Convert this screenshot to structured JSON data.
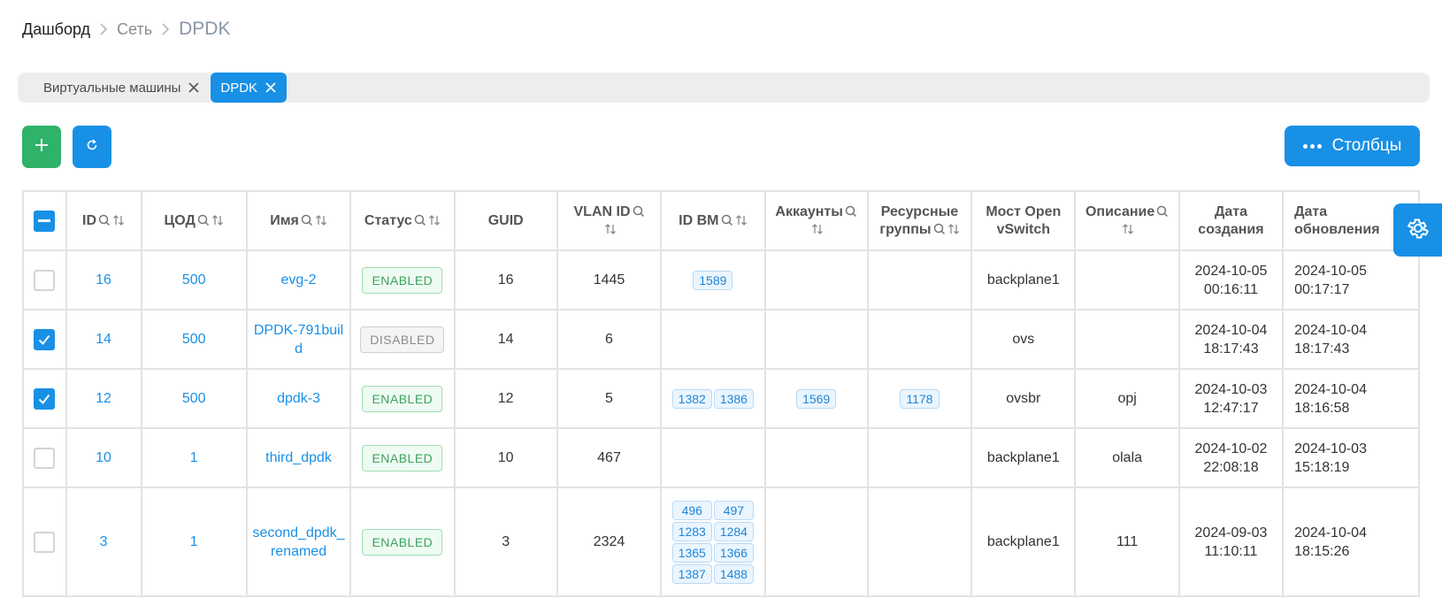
{
  "breadcrumb": {
    "home": "Дашборд",
    "section": "Сеть",
    "current": "DPDK"
  },
  "tabs": [
    {
      "label": "Виртуальные машины",
      "active": false
    },
    {
      "label": "DPDK",
      "active": true
    }
  ],
  "toolbar": {
    "add_icon": "plus-icon",
    "refresh_icon": "refresh-icon",
    "columns_label": "Столбцы"
  },
  "colors": {
    "accent": "#1890e6",
    "add": "#2fb26a",
    "enabled": "#3aa35e"
  },
  "table": {
    "headers": {
      "id": "ID",
      "dc": "ЦОД",
      "name": "Имя",
      "status": "Статус",
      "guid": "GUID",
      "vlan": "VLAN ID",
      "vm_ids": "ID ВМ",
      "accounts": "Аккаунты",
      "resource_groups": "Ресурсные группы",
      "ovs_bridge": "Мост Open vSwitch",
      "description": "Описание",
      "created": "Дата создания",
      "updated": "Дата обновления"
    },
    "rows": [
      {
        "checked": false,
        "id": "16",
        "dc": "500",
        "name": "evg-2",
        "status": "ENABLED",
        "guid": "16",
        "vlan": "1445",
        "vm_ids": [
          "1589"
        ],
        "accounts": [],
        "resource_groups": [],
        "bridge": "backplane1",
        "description": "",
        "created_date": "2024-10-05",
        "created_time": "00:16:11",
        "updated_date": "2024-10-05",
        "updated_time": "00:17:17"
      },
      {
        "checked": true,
        "id": "14",
        "dc": "500",
        "name": "DPDK-791build",
        "status": "DISABLED",
        "guid": "14",
        "vlan": "6",
        "vm_ids": [],
        "accounts": [],
        "resource_groups": [],
        "bridge": "ovs",
        "description": "",
        "created_date": "2024-10-04",
        "created_time": "18:17:43",
        "updated_date": "2024-10-04",
        "updated_time": "18:17:43"
      },
      {
        "checked": true,
        "id": "12",
        "dc": "500",
        "name": "dpdk-3",
        "status": "ENABLED",
        "guid": "12",
        "vlan": "5",
        "vm_ids": [
          "1382",
          "1386"
        ],
        "accounts": [
          "1569"
        ],
        "resource_groups": [
          "1178"
        ],
        "bridge": "ovsbr",
        "description": "opj",
        "created_date": "2024-10-03",
        "created_time": "12:47:17",
        "updated_date": "2024-10-04",
        "updated_time": "18:16:58"
      },
      {
        "checked": false,
        "id": "10",
        "dc": "1",
        "name": "third_dpdk",
        "status": "ENABLED",
        "guid": "10",
        "vlan": "467",
        "vm_ids": [],
        "accounts": [],
        "resource_groups": [],
        "bridge": "backplane1",
        "description": "olala",
        "created_date": "2024-10-02",
        "created_time": "22:08:18",
        "updated_date": "2024-10-03",
        "updated_time": "15:18:19"
      },
      {
        "checked": false,
        "id": "3",
        "dc": "1",
        "name": "second_dpdk_renamed",
        "status": "ENABLED",
        "guid": "3",
        "vlan": "2324",
        "vm_ids": [
          "496",
          "497",
          "1283",
          "1284",
          "1365",
          "1366",
          "1387",
          "1488"
        ],
        "accounts": [],
        "resource_groups": [],
        "bridge": "backplane1",
        "description": "111",
        "created_date": "2024-09-03",
        "created_time": "11:10:11",
        "updated_date": "2024-10-04",
        "updated_time": "18:15:26"
      }
    ]
  }
}
